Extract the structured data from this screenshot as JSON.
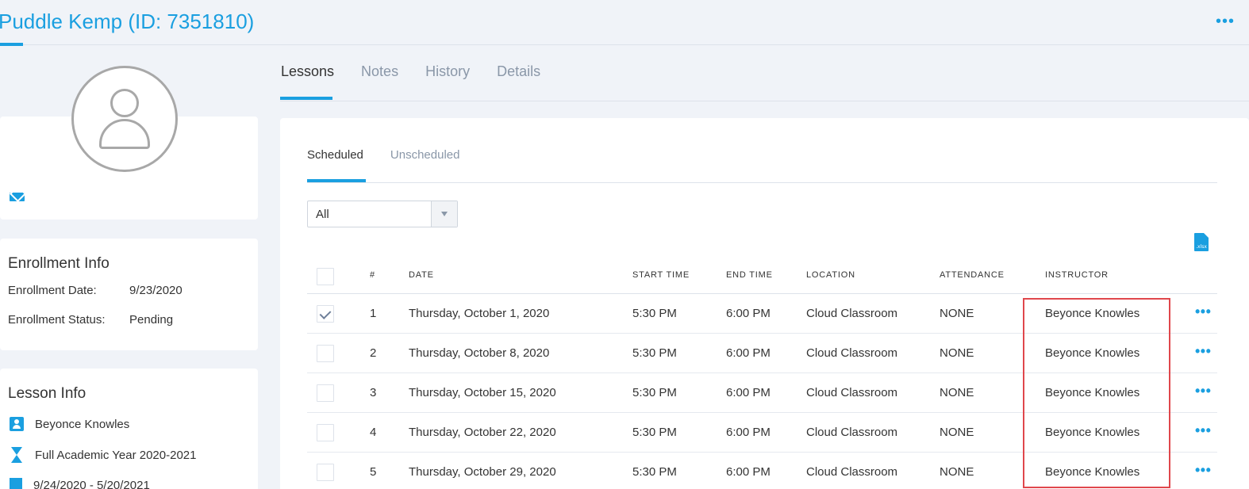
{
  "header": {
    "title": "Puddle Kemp (ID: 7351810)",
    "more_label": "•••"
  },
  "profile": {
    "avatar_icon": "user-avatar-icon",
    "email_icon": "envelope-icon"
  },
  "enrollment_info": {
    "heading": "Enrollment Info",
    "date_label": "Enrollment Date:",
    "date_value": "9/23/2020",
    "status_label": "Enrollment Status:",
    "status_value": "Pending"
  },
  "lesson_info": {
    "heading": "Lesson Info",
    "instructor": "Beyonce Knowles",
    "term": "Full Academic Year 2020-2021",
    "date_range": "9/24/2020 - 5/20/2021"
  },
  "main_tabs": [
    {
      "label": "Lessons",
      "active": true
    },
    {
      "label": "Notes",
      "active": false
    },
    {
      "label": "History",
      "active": false
    },
    {
      "label": "Details",
      "active": false
    }
  ],
  "sub_tabs": [
    {
      "label": "Scheduled",
      "active": true
    },
    {
      "label": "Unscheduled",
      "active": false
    }
  ],
  "filter": {
    "selected": "All"
  },
  "export": {
    "icon_label": ".xlsx"
  },
  "table": {
    "columns": [
      "#",
      "DATE",
      "START TIME",
      "END TIME",
      "LOCATION",
      "ATTENDANCE",
      "INSTRUCTOR"
    ],
    "rows": [
      {
        "num": "1",
        "date": "Thursday, October 1, 2020",
        "start": "5:30 PM",
        "end": "6:00 PM",
        "location": "Cloud Classroom",
        "attendance": "NONE",
        "instructor": "Beyonce Knowles",
        "checked": true
      },
      {
        "num": "2",
        "date": "Thursday, October 8, 2020",
        "start": "5:30 PM",
        "end": "6:00 PM",
        "location": "Cloud Classroom",
        "attendance": "NONE",
        "instructor": "Beyonce Knowles",
        "checked": false
      },
      {
        "num": "3",
        "date": "Thursday, October 15, 2020",
        "start": "5:30 PM",
        "end": "6:00 PM",
        "location": "Cloud Classroom",
        "attendance": "NONE",
        "instructor": "Beyonce Knowles",
        "checked": false
      },
      {
        "num": "4",
        "date": "Thursday, October 22, 2020",
        "start": "5:30 PM",
        "end": "6:00 PM",
        "location": "Cloud Classroom",
        "attendance": "NONE",
        "instructor": "Beyonce Knowles",
        "checked": false
      },
      {
        "num": "5",
        "date": "Thursday, October 29, 2020",
        "start": "5:30 PM",
        "end": "6:00 PM",
        "location": "Cloud Classroom",
        "attendance": "NONE",
        "instructor": "Beyonce Knowles",
        "checked": false
      }
    ],
    "row_more_label": "•••"
  },
  "colors": {
    "accent": "#1a9fe0",
    "highlight": "#e0474c",
    "background": "#f0f3f8"
  }
}
